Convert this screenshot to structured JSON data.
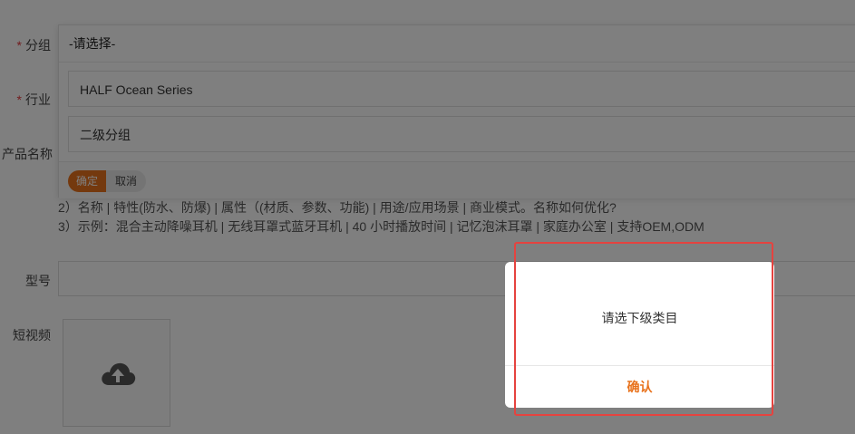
{
  "form": {
    "group_label": "分组",
    "industry_label": "行业",
    "product_name_label": "产品名称",
    "model_label": "型号",
    "short_video_label": "短视频",
    "required_mark": "*"
  },
  "dropdown": {
    "placeholder": "-请选择-",
    "options": [
      "HALF Ocean Series",
      "二级分组"
    ],
    "confirm_label": "确定",
    "cancel_label": "取消"
  },
  "hints": {
    "line2": "2）名称 | 特性(防水、防爆) | 属性（(材质、参数、功能) | 用途/应用场景 | 商业模式。名称如何优化?",
    "line3": "3）示例：混合主动降噪耳机 | 无线耳罩式蓝牙耳机 | 40 小时播放时间 | 记忆泡沫耳罩 | 家庭办公室 | 支持OEM,ODM"
  },
  "upload": {
    "icon": "cloud-upload-icon"
  },
  "modal": {
    "message": "请选下级类目",
    "confirm_label": "确认"
  },
  "colors": {
    "accent": "#e8721c",
    "required": "#e4393c",
    "highlight": "#e5433f"
  }
}
